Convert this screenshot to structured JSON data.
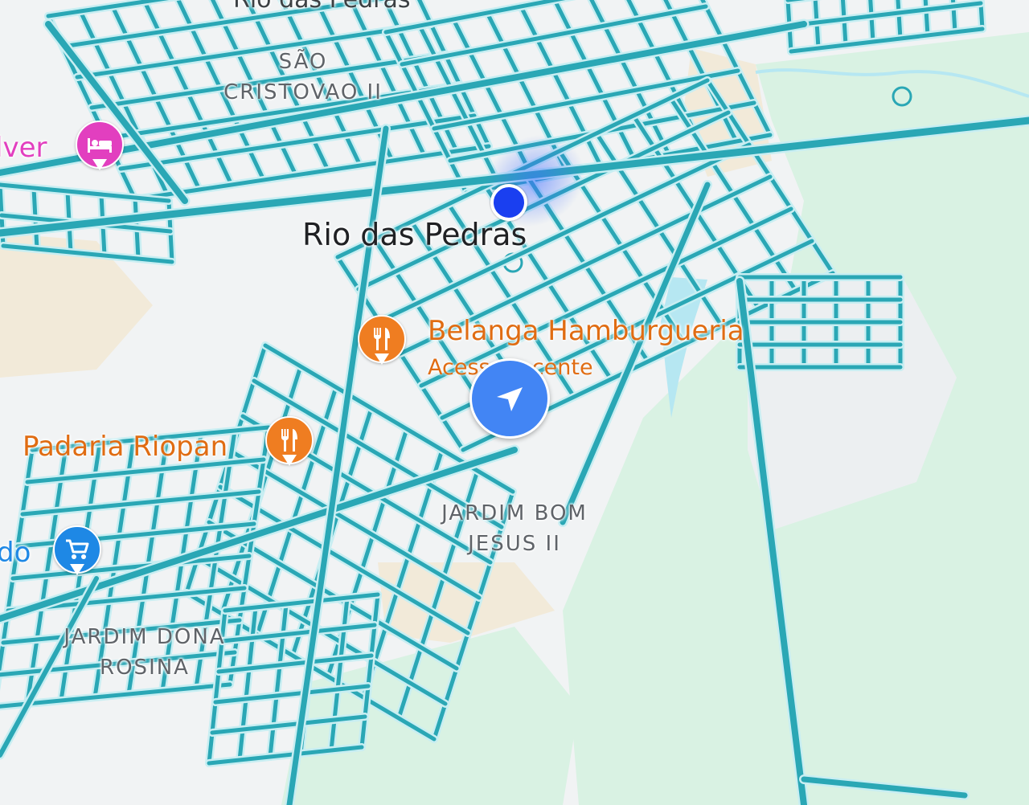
{
  "map": {
    "city": "Rio das Pedras",
    "city_top": "Rio das Pedras",
    "areas": {
      "sao_cristovao_line1": "SÃO",
      "sao_cristovao_line2": "CRISTOVAO II",
      "bom_jesus_line1": "JARDIM BOM",
      "bom_jesus_line2": "JESUS II",
      "dona_rosina_line1": "JARDIM DONA",
      "dona_rosina_line2": "ROSINA"
    },
    "pois": {
      "hotel": {
        "name": "lver",
        "icon": "hotel-bed-icon",
        "color": "#e23fbf"
      },
      "belanga": {
        "name": "Belanga Hamburgueria",
        "subtitle": "Acesso recente",
        "icon": "restaurant-icon",
        "color": "#ef7d21"
      },
      "padaria": {
        "name": "Padaria Riopan",
        "icon": "restaurant-icon",
        "color": "#ef7d21"
      },
      "market": {
        "name": "do",
        "icon": "shopping-cart-icon",
        "color": "#1e88e5"
      }
    },
    "colors": {
      "road": "#2aa7b5",
      "road_casing": "#c8eef2",
      "green": "#d9f2e3",
      "sand": "#f2ead9",
      "water": "#b6e7f2",
      "location": "#1a3ff0",
      "nav": "#4285f4"
    }
  }
}
